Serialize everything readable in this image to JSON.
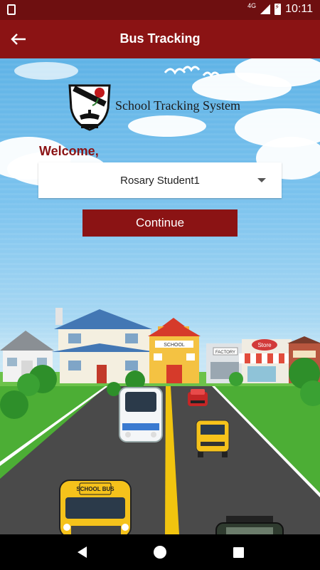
{
  "status_bar": {
    "network": "4G",
    "time": "10:11"
  },
  "app_bar": {
    "title": "Bus Tracking"
  },
  "logo": {
    "text": "School Tracking System",
    "crest_top": "ROSARY SCHOOL",
    "crest_bottom": "SHARJAH"
  },
  "form": {
    "welcome": "Welcome,",
    "selected_student": "Rosary Student1",
    "continue_label": "Continue"
  },
  "scene": {
    "bus_sign": "SCHOOL BUS",
    "school_sign": "SCHOOL",
    "factory_sign": "FACTORY",
    "store_sign": "Store"
  },
  "colors": {
    "primary": "#8b1314",
    "status_bar": "#6e0f10"
  }
}
